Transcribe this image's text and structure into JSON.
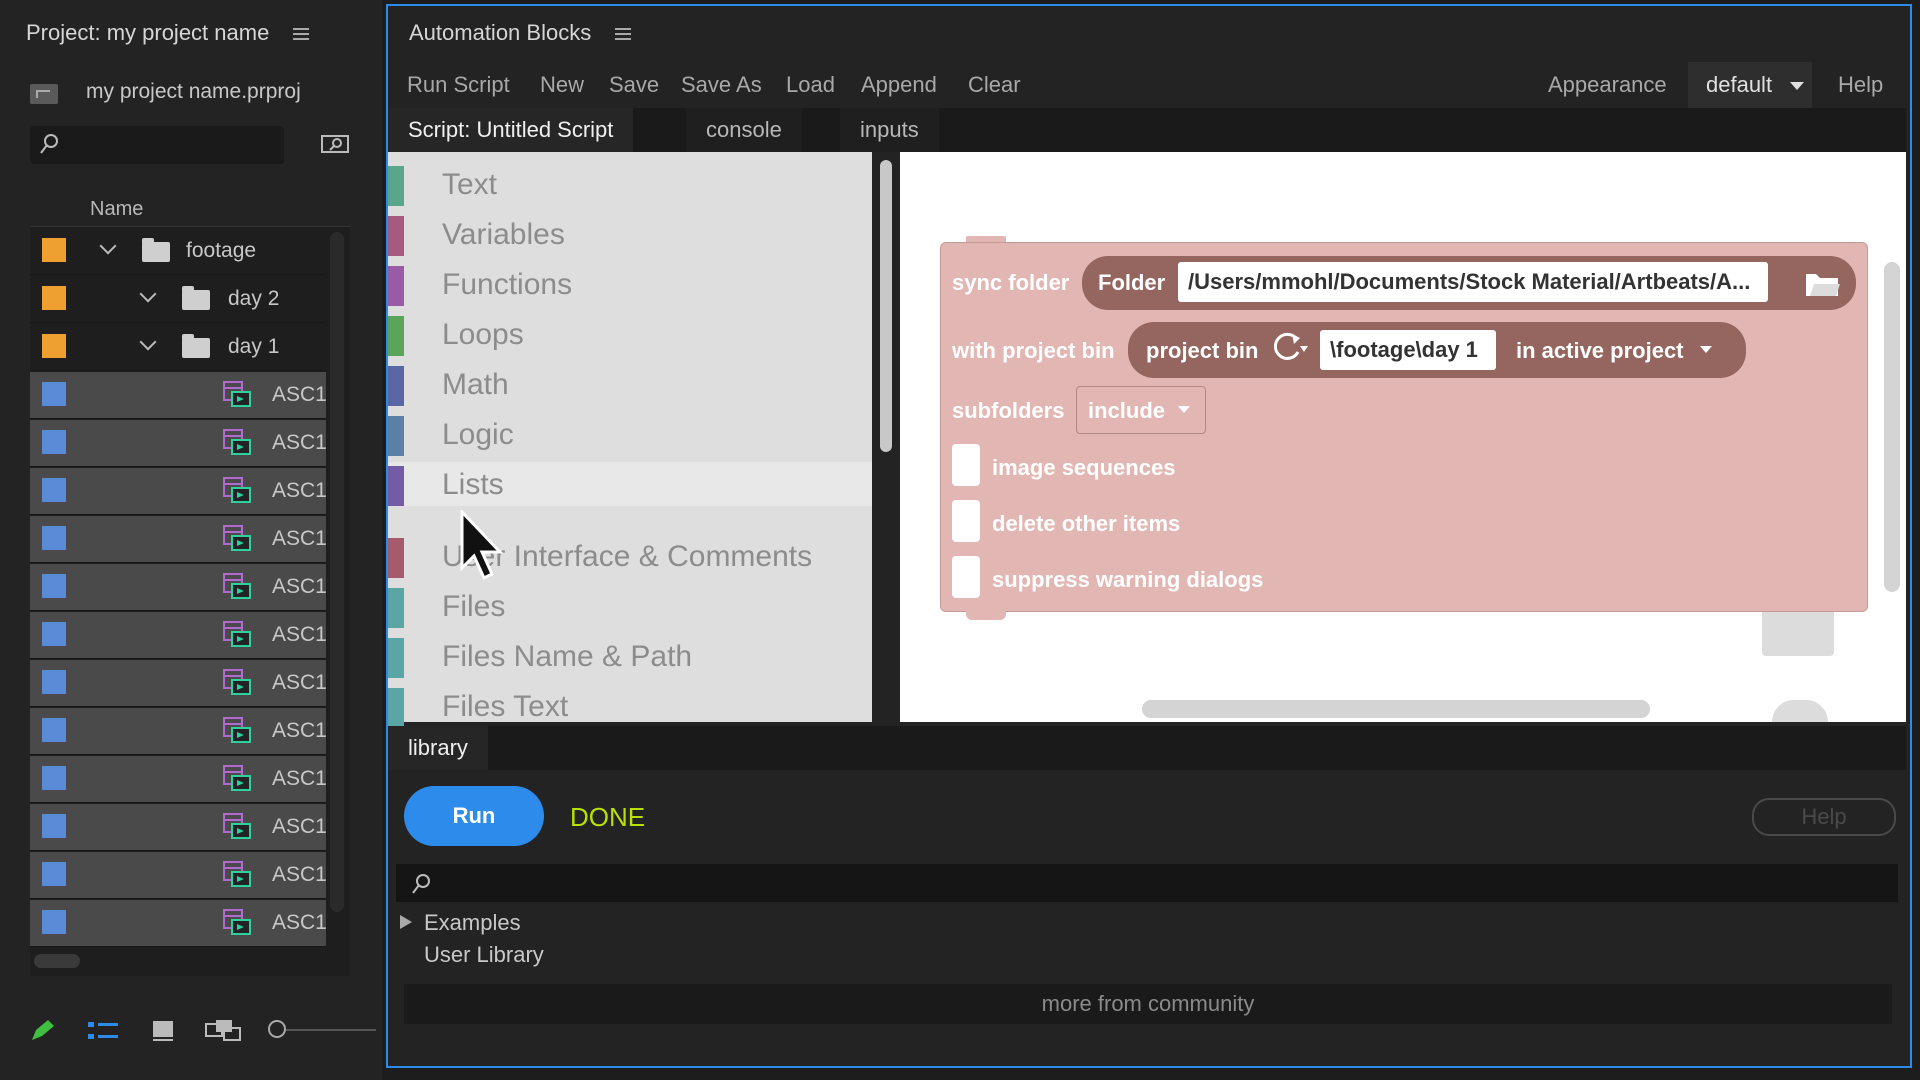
{
  "project": {
    "title": "Project: my project name",
    "file_name": "my project name.prproj",
    "column_name": "Name",
    "rows": [
      {
        "label": "footage",
        "kind": "folder",
        "color": "#f0a030",
        "indent": 0
      },
      {
        "label": "day 2",
        "kind": "folder",
        "color": "#f0a030",
        "indent": 1
      },
      {
        "label": "day 1",
        "kind": "folder",
        "color": "#f0a030",
        "indent": 1
      },
      {
        "label": "ASC1",
        "kind": "clip",
        "color": "#5b8ad6"
      },
      {
        "label": "ASC1",
        "kind": "clip",
        "color": "#5b8ad6"
      },
      {
        "label": "ASC1",
        "kind": "clip",
        "color": "#5b8ad6"
      },
      {
        "label": "ASC1",
        "kind": "clip",
        "color": "#5b8ad6"
      },
      {
        "label": "ASC1",
        "kind": "clip",
        "color": "#5b8ad6"
      },
      {
        "label": "ASC1",
        "kind": "clip",
        "color": "#5b8ad6"
      },
      {
        "label": "ASC1",
        "kind": "clip",
        "color": "#5b8ad6"
      },
      {
        "label": "ASC1",
        "kind": "clip",
        "color": "#5b8ad6"
      },
      {
        "label": "ASC1",
        "kind": "clip",
        "color": "#5b8ad6"
      },
      {
        "label": "ASC1",
        "kind": "clip",
        "color": "#5b8ad6"
      },
      {
        "label": "ASC1",
        "kind": "clip",
        "color": "#5b8ad6"
      },
      {
        "label": "ASC1",
        "kind": "clip",
        "color": "#5b8ad6"
      }
    ]
  },
  "automation": {
    "title": "Automation Blocks",
    "menu": [
      "Run Script",
      "New",
      "Save",
      "Save As",
      "Load",
      "Append",
      "Clear"
    ],
    "appearance_label": "Appearance",
    "theme": "default",
    "help": "Help",
    "tabs": [
      "Script: Untitled Script",
      "console",
      "inputs"
    ],
    "categories": [
      {
        "label": "Text",
        "color": "#5ba58c"
      },
      {
        "label": "Variables",
        "color": "#a55b80"
      },
      {
        "label": "Functions",
        "color": "#995ba5"
      },
      {
        "label": "Loops",
        "color": "#5ba55b"
      },
      {
        "label": "Math",
        "color": "#5b67a5"
      },
      {
        "label": "Logic",
        "color": "#5b80a5"
      },
      {
        "label": "Lists",
        "color": "#745ba5"
      },
      {
        "label": "User Interface & Comments",
        "color": "#a55b6e"
      },
      {
        "label": "Files",
        "color": "#5ba5a5"
      },
      {
        "label": "Files Name & Path",
        "color": "#5ba5a5"
      },
      {
        "label": "Files Text",
        "color": "#5ba5a5"
      }
    ],
    "block": {
      "label": "sync folder",
      "folder_label": "Folder",
      "folder_path": "/Users/mmohl/Documents/Stock Material/Artbeats/A...",
      "bin_label": "with project bin",
      "bin_pill_label": "project bin",
      "bin_path": "\\footage\\day 1",
      "bin_scope": "in active project",
      "subfolders_label": "subfolders",
      "subfolders_value": "include",
      "checkboxes": [
        "image sequences",
        "delete other items",
        "suppress warning dialogs"
      ]
    },
    "library": {
      "tab": "library",
      "run": "Run",
      "status": "DONE",
      "help": "Help",
      "examples": "Examples",
      "user_library": "User Library",
      "community": "more from community"
    }
  }
}
